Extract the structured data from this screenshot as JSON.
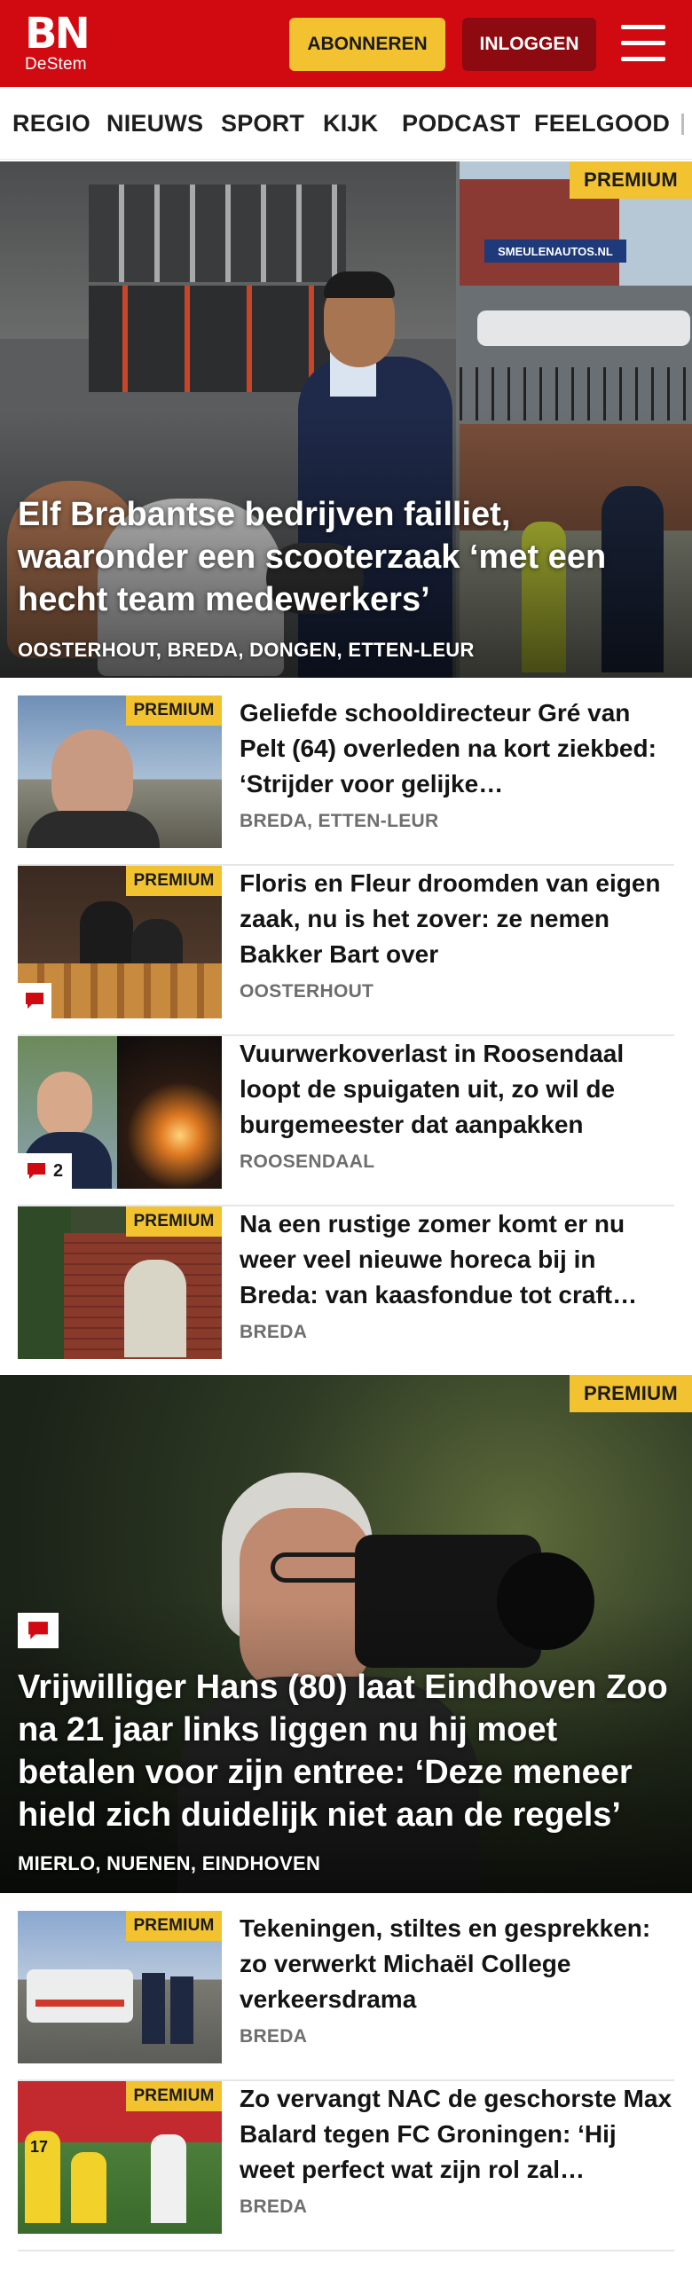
{
  "header": {
    "logo_text": "BN",
    "logo_sub": "DeStem",
    "subscribe_label": "ABONNEREN",
    "login_label": "INLOGGEN",
    "brand_color": "#d10a11",
    "accent_color": "#f2c231",
    "menu_icon": "hamburger-icon"
  },
  "nav": {
    "items": [
      "REGIO",
      "NIEUWS",
      "SPORT",
      "KIJK",
      "PODCAST",
      "FEELGOOD"
    ]
  },
  "hero1": {
    "badge": "PREMIUM",
    "title": "Elf Brabantse bedrijven failliet, waaronder een scooterzaak ‘met een hecht team medewerkers’",
    "locations": "OOSTERHOUT, BREDA, DONGEN, ETTEN-LEUR",
    "sign_text": "SMEULENAUTOS.NL"
  },
  "articles": [
    {
      "badge": "PREMIUM",
      "title": "Geliefde schooldirecteur Gré van Pelt (64) overleden na kort ziekbed: ‘Strijder voor gelijke…",
      "location": "BREDA, ETTEN-LEUR",
      "comments": ""
    },
    {
      "badge": "PREMIUM",
      "title": "Floris en Fleur droomden van eigen zaak, nu is het zover: ze nemen Bakker Bart over",
      "location": "OOSTERHOUT",
      "comments": ""
    },
    {
      "badge": "",
      "title": "Vuurwerkoverlast in Roosendaal loopt de spuigaten uit, zo wil de burgemeester dat aanpakken",
      "location": "ROOSENDAAL",
      "comments": "2"
    },
    {
      "badge": "PREMIUM",
      "title": "Na een rustige zomer komt er nu weer veel nieuwe horeca bij in Breda: van kaasfondue tot craft…",
      "location": "BREDA",
      "comments": ""
    }
  ],
  "hero2": {
    "badge": "PREMIUM",
    "title": "Vrijwilliger Hans (80) laat Eindhoven Zoo na 21 jaar links liggen nu hij moet betalen voor zijn entree: ‘Deze meneer hield zich duidelijk niet aan de regels’",
    "locations": "MIERLO, NUENEN, EINDHOVEN"
  },
  "articles2": [
    {
      "badge": "PREMIUM",
      "title": "Tekeningen, stiltes en gesprekken: zo verwerkt Michaël College verkeersdrama",
      "location": "BREDA"
    },
    {
      "badge": "PREMIUM",
      "title": "Zo vervangt NAC de geschorste Max Balard tegen FC Groningen: ‘Hij weet perfect wat zijn rol zal…",
      "location": "BREDA",
      "shirt_text": "17"
    }
  ]
}
